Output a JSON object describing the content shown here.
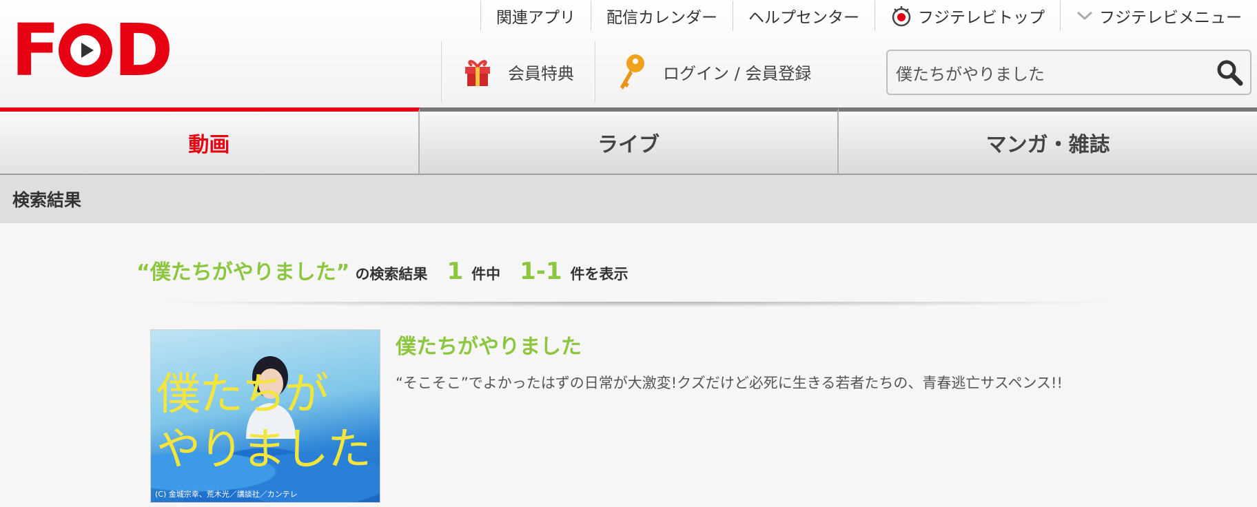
{
  "logo": {
    "text_left": "F",
    "text_right": "D"
  },
  "topnav": [
    {
      "label": "関連アプリ",
      "icon": ""
    },
    {
      "label": "配信カレンダー",
      "icon": ""
    },
    {
      "label": "ヘルプセンター",
      "icon": ""
    },
    {
      "label": "フジテレビトップ",
      "icon": "fuji-eye-icon"
    },
    {
      "label": "フジテレビメニュー",
      "icon": "chevron-down-icon"
    }
  ],
  "subnav": [
    {
      "label": "会員特典",
      "icon": "gift-icon"
    },
    {
      "label": "ログイン / 会員登録",
      "icon": "key-icon"
    }
  ],
  "search": {
    "value": "僕たちがやりました"
  },
  "tabs": [
    {
      "label": "動画",
      "active": true
    },
    {
      "label": "ライブ",
      "active": false
    },
    {
      "label": "マンガ・雑誌",
      "active": false
    }
  ],
  "breadcrumb": "検索結果",
  "summary": {
    "query": "“僕たちがやりました”",
    "text1": "の検索結果",
    "count": "1",
    "text2": "件中",
    "range": "1-1",
    "text3": "件を表示"
  },
  "results": [
    {
      "title": "僕たちがやりました",
      "description": "“そこそこ”でよかったはずの日常が大激変!クズだけど必死に生きる若者たちの、青春逃亡サスペンス!!",
      "thumb_art_text": "僕たちが\nやりました",
      "thumb_credit": "(C) 金城宗幸、荒木光／講談社／カンテレ"
    }
  ],
  "colors": {
    "brand": "#e60012",
    "accent_green": "#8cc63f"
  }
}
